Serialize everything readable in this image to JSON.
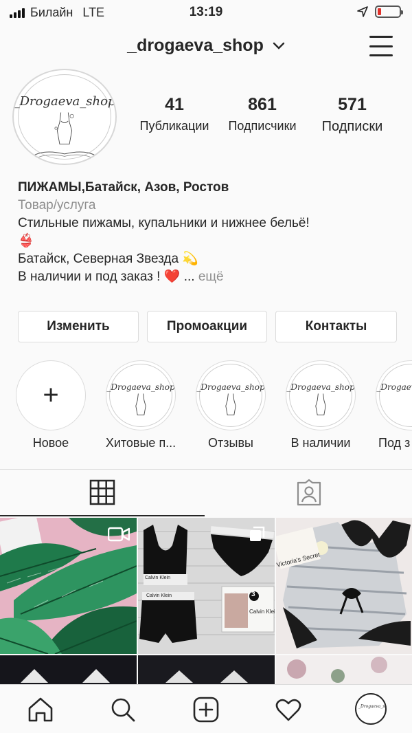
{
  "status": {
    "carrier": "Билайн",
    "network": "LTE",
    "time": "13:19"
  },
  "header": {
    "username": "_drogaeva_shop"
  },
  "logo": {
    "text": "_Drogaeva_shop"
  },
  "stats": [
    {
      "value": "41",
      "label": "Публикации"
    },
    {
      "value": "861",
      "label": "Подписчики"
    },
    {
      "value": "571",
      "label": "Подписки"
    }
  ],
  "bio": {
    "name": "ПИЖАМЫ,Батайск, Азов, Ростов",
    "category": "Товар/услуга",
    "line1": "Стильные пижамы, купальники и нижнее бельё!",
    "line2_emoji": "👙",
    "line3": "Батайск, Северная Звезда",
    "line3_emoji": "💫",
    "line4": "В наличии и под заказ !",
    "line4_emoji": "❤️",
    "ellipsis": "...",
    "more": "ещё"
  },
  "buttons": {
    "edit": "Изменить",
    "promo": "Промоакции",
    "contacts": "Контакты"
  },
  "highlights": [
    {
      "label": "Новое"
    },
    {
      "label": "Хитовые п..."
    },
    {
      "label": "Отзывы"
    },
    {
      "label": "В наличии"
    },
    {
      "label": "Под з"
    }
  ],
  "tabs": [
    {
      "icon": "grid-icon"
    },
    {
      "icon": "tagged-icon"
    }
  ],
  "posts": [
    {
      "name": "palm-leaf pajama",
      "badge": "video-icon"
    },
    {
      "name": "Calvin Klein underwear set",
      "badge": "multi-icon",
      "box_number": "3",
      "brand": "Calvin Klein",
      "brand_lines": [
        "Calvin Klein",
        "Calvin Klein"
      ]
    },
    {
      "name": "striped satin pajama with lace",
      "label": "Victoria's Secret"
    }
  ],
  "bottom_nav": [
    {
      "icon": "home-icon"
    },
    {
      "icon": "search-icon"
    },
    {
      "icon": "new-post-icon"
    },
    {
      "icon": "activity-heart-icon"
    },
    {
      "icon": "profile-avatar"
    }
  ],
  "colors": {
    "accent": "#262626",
    "muted": "#8e8e8e",
    "border": "#dbdbdb",
    "heart": "#e0242f",
    "battery": "#e0322b"
  }
}
